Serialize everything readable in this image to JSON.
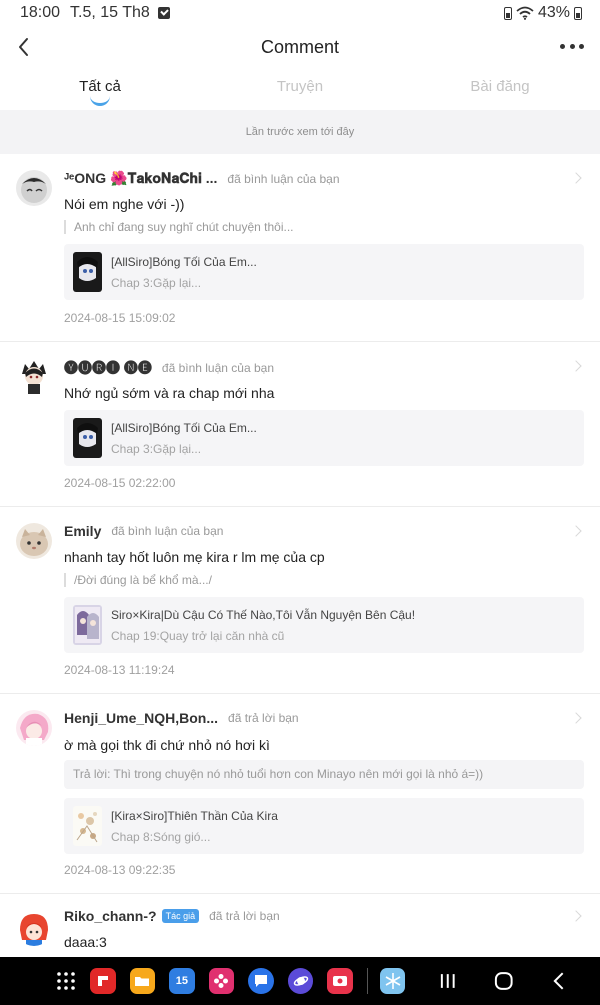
{
  "status": {
    "time": "18:00",
    "date": "T.5, 15 Th8",
    "battery": "43%"
  },
  "header": {
    "title": "Comment"
  },
  "tabs": [
    {
      "label": "Tất cả",
      "active": true
    },
    {
      "label": "Truyện",
      "active": false
    },
    {
      "label": "Bài đăng",
      "active": false
    }
  ],
  "banner": "Lần trước xem tới đây",
  "comments": [
    {
      "username": "ᴶᵉONG 🌺𝐓𝐚𝐤𝐨𝐍𝐚𝐂𝐡𝐢 ...",
      "action": "đã bình luận của bạn",
      "text": "Nói em nghe với -))",
      "quote": "Anh chỉ đang suy nghĩ chút chuyện thôi...",
      "story_title": "[AllSiro]Bóng Tối Của Em...",
      "story_chapter": "Chap 3:Gặp lại...",
      "timestamp": "2024-08-15 15:09:02"
    },
    {
      "username": "🅨🅤🅡🅘 🅝🅔",
      "action": "đã bình luận của bạn",
      "text": "Nhớ ngủ sớm  và ra chap mới nha",
      "story_title": "[AllSiro]Bóng Tối Của Em...",
      "story_chapter": "Chap 3:Gặp lại...",
      "timestamp": "2024-08-15 02:22:00"
    },
    {
      "username": "Emily",
      "action": "đã bình luận của bạn",
      "text": "nhanh tay hốt luôn mẹ kira r lm mẹ của cp",
      "quote": "/Đời đúng là bể khổ mà.../",
      "story_title": "Siro×Kira|Dù Cậu Có Thế Nào,Tôi Vẫn Nguyện Bên Cậu!",
      "story_chapter": "Chap 19:Quay trở lại căn nhà cũ",
      "timestamp": "2024-08-13 11:19:24"
    },
    {
      "username": "Henji_Ume_NQH,Bon...",
      "action": "đã trả lời bạn",
      "text": "ờ mà gọi thk đi chứ nhỏ nó hơi kì",
      "reply": "Trả lời: Thì trong chuyện nó nhỏ tuổi hơn con Minayo nên mới gọi là nhỏ á=))",
      "story_title": "[Kira×Siro]Thiên Thần Của Kira",
      "story_chapter": "Chap 8:Sóng gió...",
      "timestamp": "2024-08-13 09:22:35"
    },
    {
      "username": "Riko_chann-?",
      "badge": "Tác giả",
      "action": "đã trả lời bạn",
      "text": "daaa:3"
    }
  ],
  "colors": {
    "accent": "#4aa3e8",
    "badge": "#4a9eea",
    "nav_bg": "#000000"
  },
  "nav_icons": [
    "apps-grid-icon",
    "flipboard-icon",
    "files-icon",
    "calendar-icon",
    "flower-icon",
    "messages-icon",
    "internet-icon",
    "screen-recorder-icon",
    "snowflake-icon"
  ],
  "nav_calendar_day": "15"
}
